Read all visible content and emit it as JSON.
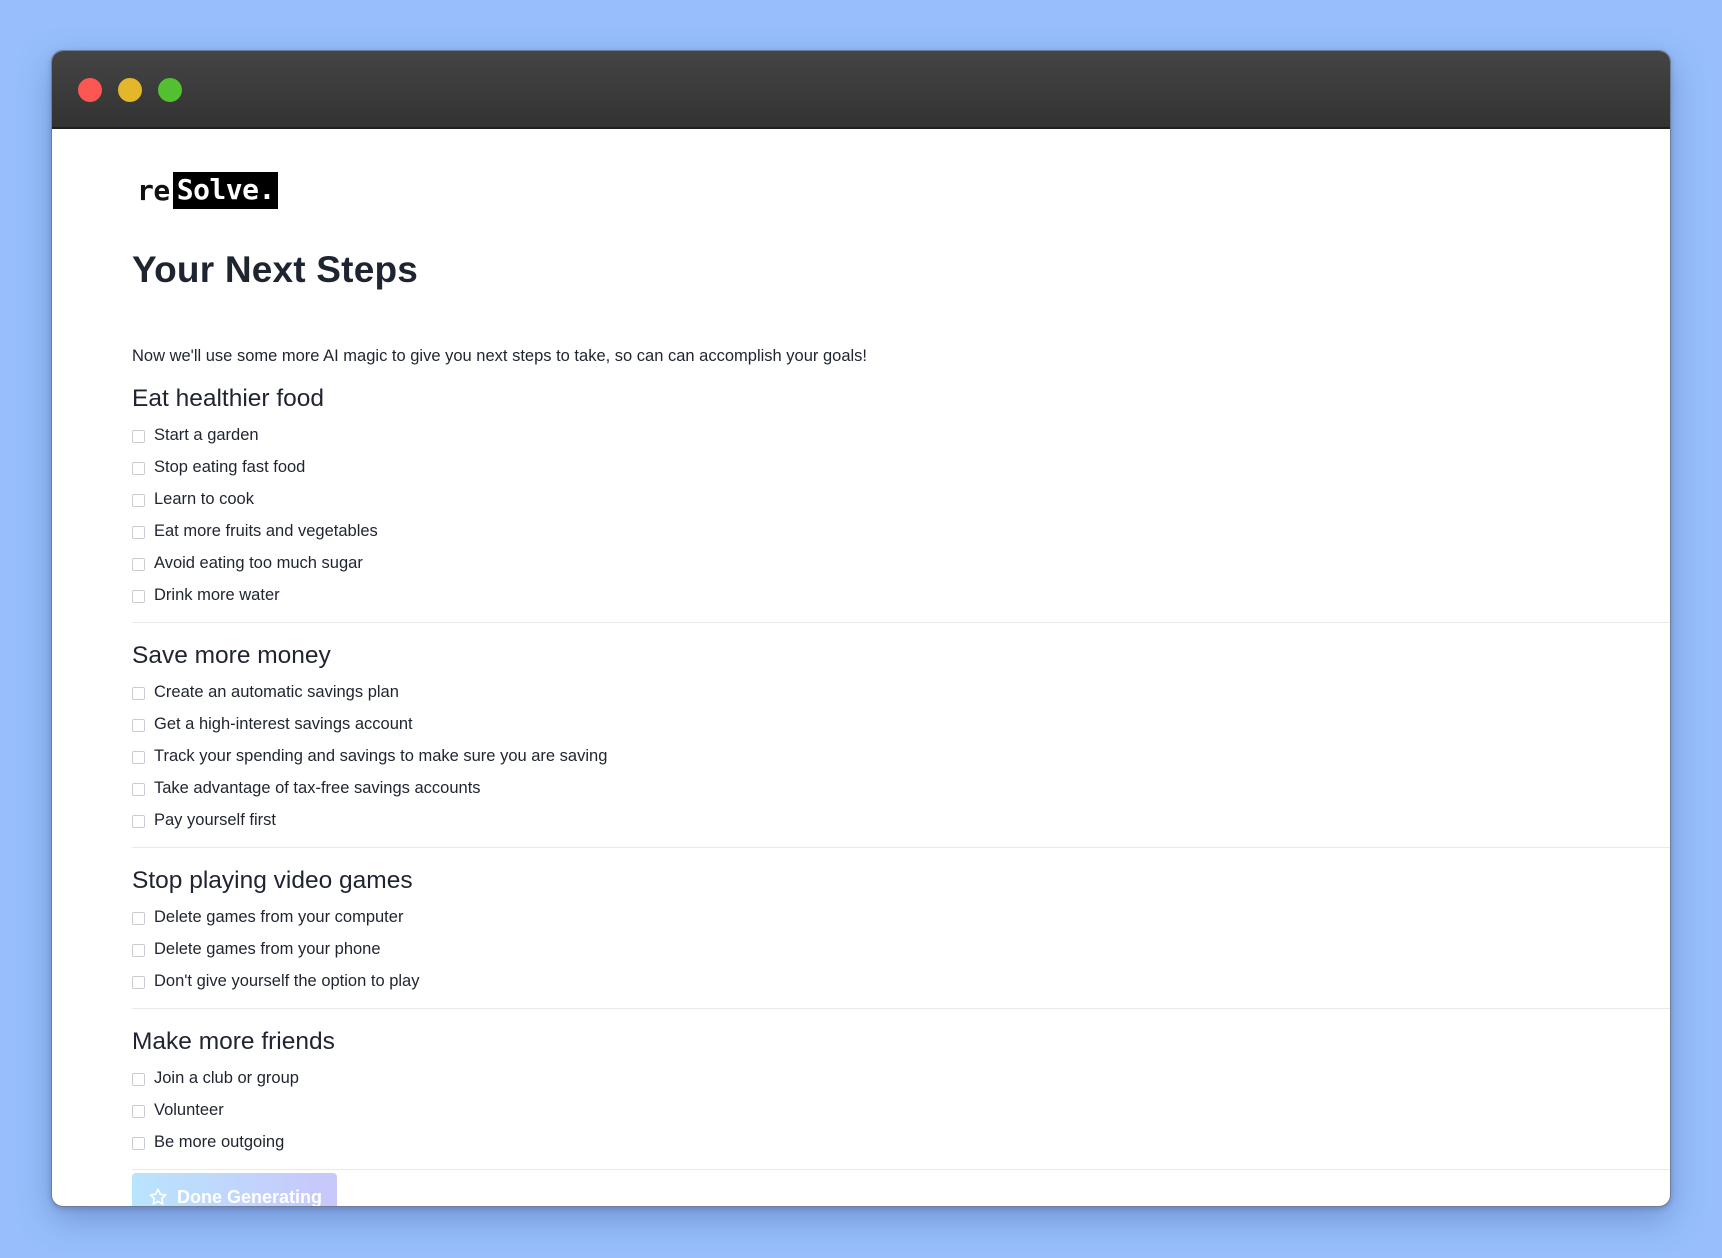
{
  "logo": {
    "prefix": "re",
    "highlight": "Solve."
  },
  "page": {
    "title": "Your Next Steps",
    "subtitle": "Now we'll use some more AI magic to give you next steps to take, so can can accomplish your goals!"
  },
  "sections": [
    {
      "title": "Eat healthier food",
      "tasks": [
        "Start a garden",
        "Stop eating fast food",
        "Learn to cook",
        "Eat more fruits and vegetables",
        "Avoid eating too much sugar",
        "Drink more water"
      ]
    },
    {
      "title": "Save more money",
      "tasks": [
        "Create an automatic savings plan",
        "Get a high-interest savings account",
        "Track your spending and savings to make sure you are saving",
        "Take advantage of tax-free savings accounts",
        "Pay yourself first"
      ]
    },
    {
      "title": "Stop playing video games",
      "tasks": [
        "Delete games from your computer",
        "Delete games from your phone",
        "Don't give yourself the option to play"
      ]
    },
    {
      "title": "Make more friends",
      "tasks": [
        "Join a club or group",
        "Volunteer",
        "Be more outgoing"
      ]
    }
  ],
  "footer": {
    "button_label": "Done Generating",
    "button_icon": "star-icon"
  },
  "colors": {
    "background": "#98bffc",
    "titlebar": "#383838",
    "button_gradient_start": "#b9e4fd",
    "button_gradient_end": "#c8c7fb"
  }
}
